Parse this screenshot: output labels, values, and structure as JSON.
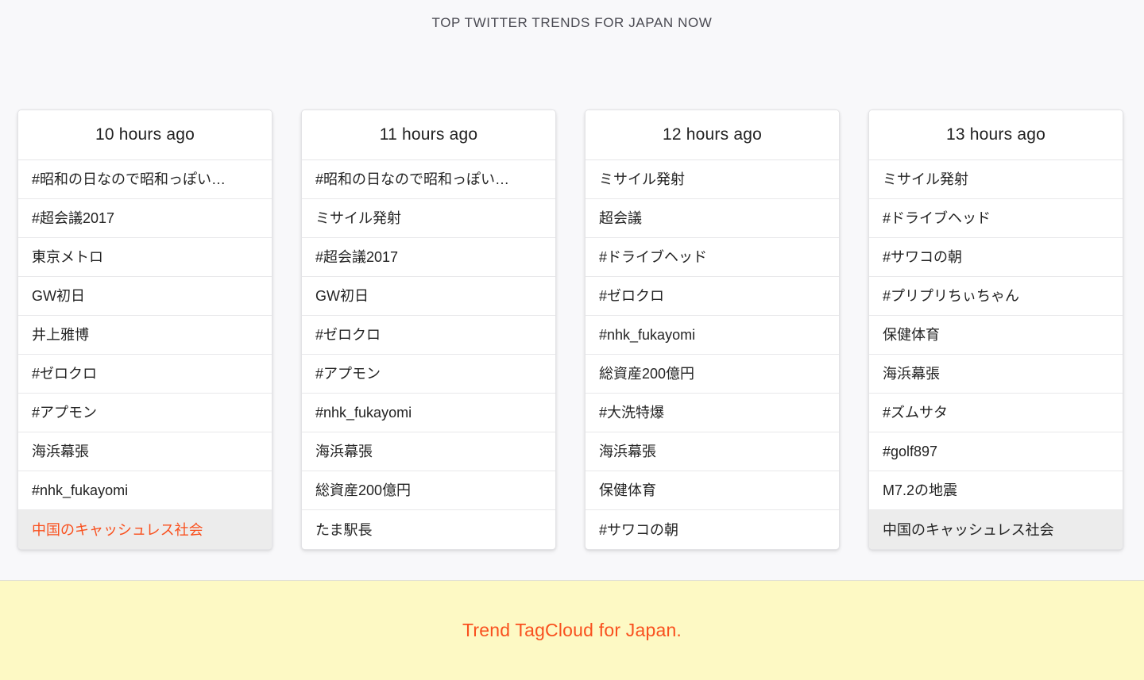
{
  "header": {
    "title": "TOP TWITTER TRENDS FOR JAPAN NOW"
  },
  "colors": {
    "accent": "#f9501e",
    "page_background": "#f8f8fa",
    "card_background": "#ffffff",
    "footer_background": "#fdf9c4",
    "highlight_row": "#ececec",
    "text": "#232323",
    "border": "#e8e8ea"
  },
  "columns": [
    {
      "title": "10 hours ago",
      "items": [
        {
          "label": "#昭和の日なので昭和っぽい…",
          "highlight": false,
          "accent": false
        },
        {
          "label": "#超会議2017",
          "highlight": false,
          "accent": false
        },
        {
          "label": "東京メトロ",
          "highlight": false,
          "accent": false
        },
        {
          "label": "GW初日",
          "highlight": false,
          "accent": false
        },
        {
          "label": "井上雅博",
          "highlight": false,
          "accent": false
        },
        {
          "label": "#ゼロクロ",
          "highlight": false,
          "accent": false
        },
        {
          "label": "#アプモン",
          "highlight": false,
          "accent": false
        },
        {
          "label": "海浜幕張",
          "highlight": false,
          "accent": false
        },
        {
          "label": "#nhk_fukayomi",
          "highlight": false,
          "accent": false
        },
        {
          "label": "中国のキャッシュレス社会",
          "highlight": true,
          "accent": true
        }
      ]
    },
    {
      "title": "11 hours ago",
      "items": [
        {
          "label": "#昭和の日なので昭和っぽい…",
          "highlight": false,
          "accent": false
        },
        {
          "label": "ミサイル発射",
          "highlight": false,
          "accent": false
        },
        {
          "label": "#超会議2017",
          "highlight": false,
          "accent": false
        },
        {
          "label": "GW初日",
          "highlight": false,
          "accent": false
        },
        {
          "label": "#ゼロクロ",
          "highlight": false,
          "accent": false
        },
        {
          "label": "#アプモン",
          "highlight": false,
          "accent": false
        },
        {
          "label": "#nhk_fukayomi",
          "highlight": false,
          "accent": false
        },
        {
          "label": "海浜幕張",
          "highlight": false,
          "accent": false
        },
        {
          "label": "総資産200億円",
          "highlight": false,
          "accent": false
        },
        {
          "label": "たま駅長",
          "highlight": false,
          "accent": false
        }
      ]
    },
    {
      "title": "12 hours ago",
      "items": [
        {
          "label": "ミサイル発射",
          "highlight": false,
          "accent": false
        },
        {
          "label": "超会議",
          "highlight": false,
          "accent": false
        },
        {
          "label": "#ドライブヘッド",
          "highlight": false,
          "accent": false
        },
        {
          "label": "#ゼロクロ",
          "highlight": false,
          "accent": false
        },
        {
          "label": "#nhk_fukayomi",
          "highlight": false,
          "accent": false
        },
        {
          "label": "総資産200億円",
          "highlight": false,
          "accent": false
        },
        {
          "label": "#大洗特爆",
          "highlight": false,
          "accent": false
        },
        {
          "label": "海浜幕張",
          "highlight": false,
          "accent": false
        },
        {
          "label": "保健体育",
          "highlight": false,
          "accent": false
        },
        {
          "label": "#サワコの朝",
          "highlight": false,
          "accent": false
        }
      ]
    },
    {
      "title": "13 hours ago",
      "items": [
        {
          "label": "ミサイル発射",
          "highlight": false,
          "accent": false
        },
        {
          "label": "#ドライブヘッド",
          "highlight": false,
          "accent": false
        },
        {
          "label": "#サワコの朝",
          "highlight": false,
          "accent": false
        },
        {
          "label": "#プリプリちぃちゃん",
          "highlight": false,
          "accent": false
        },
        {
          "label": "保健体育",
          "highlight": false,
          "accent": false
        },
        {
          "label": "海浜幕張",
          "highlight": false,
          "accent": false
        },
        {
          "label": "#ズムサタ",
          "highlight": false,
          "accent": false
        },
        {
          "label": "#golf897",
          "highlight": false,
          "accent": false
        },
        {
          "label": "M7.2の地震",
          "highlight": false,
          "accent": false
        },
        {
          "label": "中国のキャッシュレス社会",
          "highlight": true,
          "accent": false
        }
      ]
    }
  ],
  "footer": {
    "text": "Trend TagCloud for Japan."
  }
}
